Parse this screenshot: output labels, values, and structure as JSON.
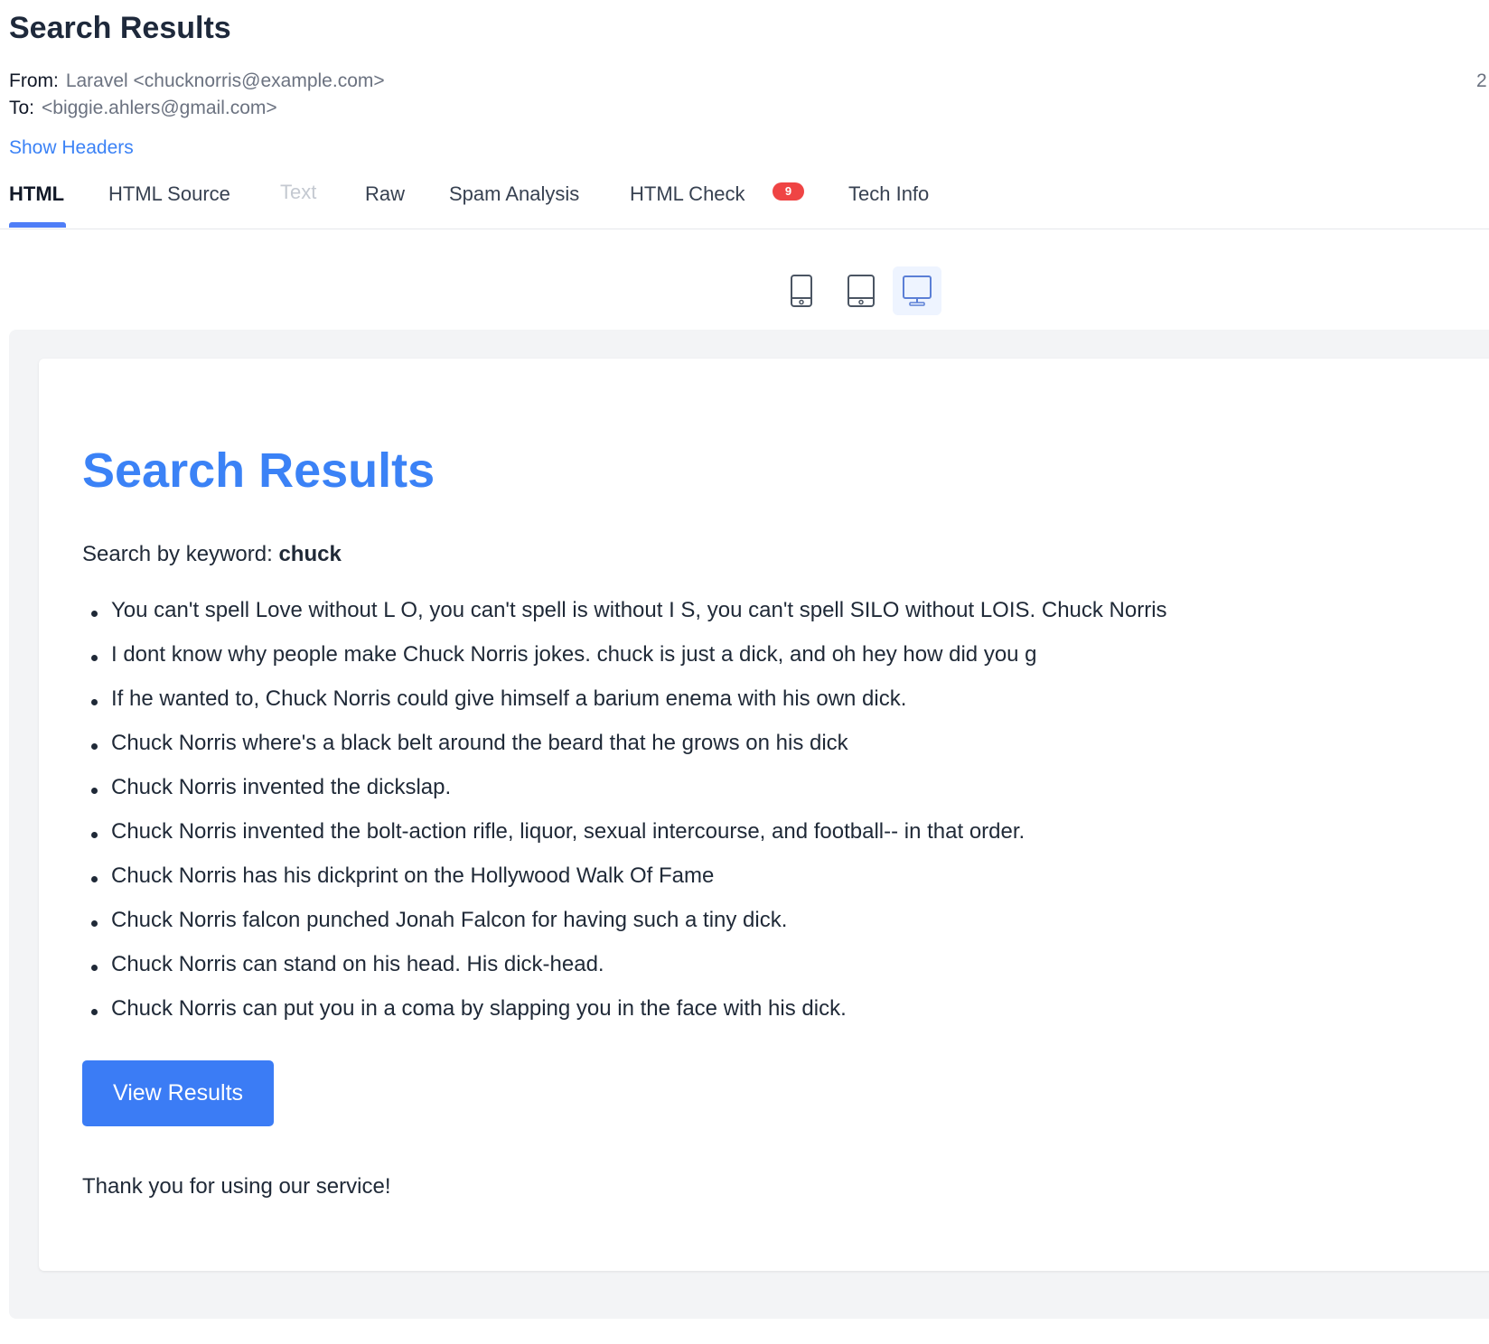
{
  "email": {
    "subject": "Search Results",
    "from_label": "From:",
    "from_value": "Laravel <chucknorris@example.com>",
    "to_label": "To:",
    "to_value": "<biggie.ahlers@gmail.com>",
    "date_partial": "2",
    "show_headers": "Show Headers"
  },
  "tabs": [
    {
      "label": "HTML",
      "active": true
    },
    {
      "label": "HTML Source"
    },
    {
      "label": "Text",
      "disabled": true
    },
    {
      "label": "Raw"
    },
    {
      "label": "Spam Analysis"
    },
    {
      "label": "HTML Check",
      "badge": "9"
    },
    {
      "label": "Tech Info"
    }
  ],
  "device_toggle": {
    "options": [
      "mobile-icon",
      "tablet-icon",
      "desktop-icon"
    ],
    "selected": "desktop-icon"
  },
  "preview": {
    "heading": "Search Results",
    "keyword_prefix": "Search by keyword:",
    "keyword": "chuck",
    "results": [
      "You can't spell Love without L O, you can't spell is without I S, you can't spell SILO without LOIS. Chuck Norris",
      "I dont know why people make Chuck Norris jokes. chuck is just a dick, and oh hey how did you g",
      "If he wanted to, Chuck Norris could give himself a barium enema with his own dick.",
      "Chuck Norris where's a black belt around the beard that he grows on his dick",
      "Chuck Norris invented the dickslap.",
      "Chuck Norris invented the bolt-action rifle, liquor, sexual intercourse, and football-- in that order.",
      "Chuck Norris has his dickprint on the Hollywood Walk Of Fame",
      "Chuck Norris falcon punched Jonah Falcon for having such a tiny dick.",
      "Chuck Norris can stand on his head. His dick-head.",
      "Chuck Norris can put you in a coma by slapping you in the face with his dick."
    ],
    "button_label": "View Results",
    "footer": "Thank you for using our service!"
  },
  "colors": {
    "accent": "#3b82f6",
    "badge": "#ef4444",
    "button": "#3b7cf5"
  }
}
